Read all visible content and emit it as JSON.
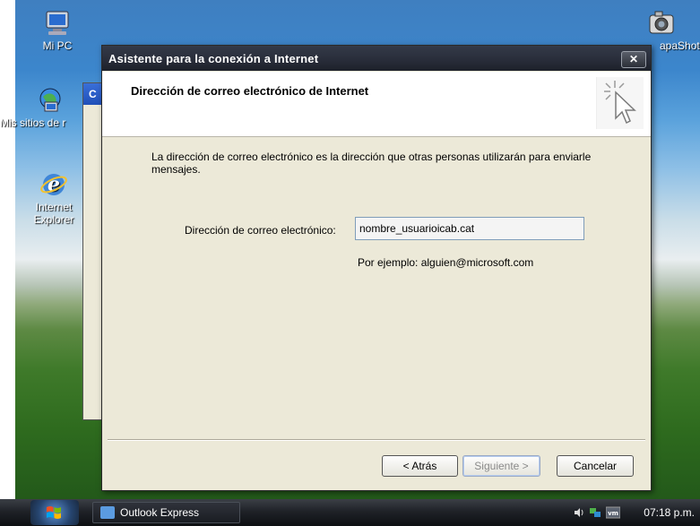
{
  "desktop": {
    "icons": [
      {
        "label": "Mi PC"
      },
      {
        "label": "Mis sitios de r"
      },
      {
        "label": "Internet Explorer"
      },
      {
        "label": "apaShot"
      }
    ]
  },
  "background_window": {
    "title": "C"
  },
  "dialog": {
    "title": "Asistente para la conexión a Internet",
    "close_label": "✕",
    "header_title": "Dirección de correo electrónico de Internet",
    "description": "La dirección de correo electrónico es la dirección que otras personas utilizarán para enviarle mensajes.",
    "email_label": "Dirección de correo electrónico:",
    "email_value": "nombre_usuarioicab.cat",
    "example": "Por ejemplo: alguien@microsoft.com",
    "buttons": {
      "back": "< Atrás",
      "next": "Siguiente >",
      "cancel": "Cancelar"
    }
  },
  "taskbar": {
    "task_label": "Outlook Express",
    "clock": "07:18 p.m."
  },
  "colors": {
    "titlebar": "#2a2f3c",
    "dialog_bg": "#ece9d8",
    "taskbar": "#1f2228"
  }
}
